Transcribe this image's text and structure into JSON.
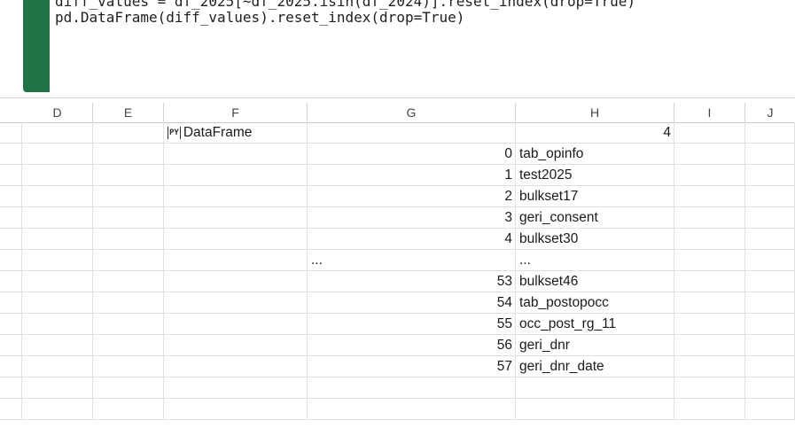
{
  "editor": {
    "lines": [
      "diff_values = df_2025[~df_2025.isin(df_2024)].reset_index(drop=True)",
      "pd.DataFrame(diff_values).reset_index(drop=True)"
    ],
    "accent": "#217346"
  },
  "columns": [
    "D",
    "E",
    "F",
    "G",
    "H",
    "I",
    "J"
  ],
  "result": {
    "badge": "PY",
    "type_label": "DataFrame",
    "count": "4",
    "rows": [
      {
        "index": "0",
        "value": "tab_opinfo"
      },
      {
        "index": "1",
        "value": "test2025"
      },
      {
        "index": "2",
        "value": "bulkset17"
      },
      {
        "index": "3",
        "value": "geri_consent"
      },
      {
        "index": "4",
        "value": "bulkset30"
      },
      {
        "index": "...",
        "value": "..."
      },
      {
        "index": "53",
        "value": "bulkset46"
      },
      {
        "index": "54",
        "value": "tab_postopocc"
      },
      {
        "index": "55",
        "value": "occ_post_rg_11"
      },
      {
        "index": "56",
        "value": "geri_dnr"
      },
      {
        "index": "57",
        "value": "geri_dnr_date"
      }
    ]
  }
}
